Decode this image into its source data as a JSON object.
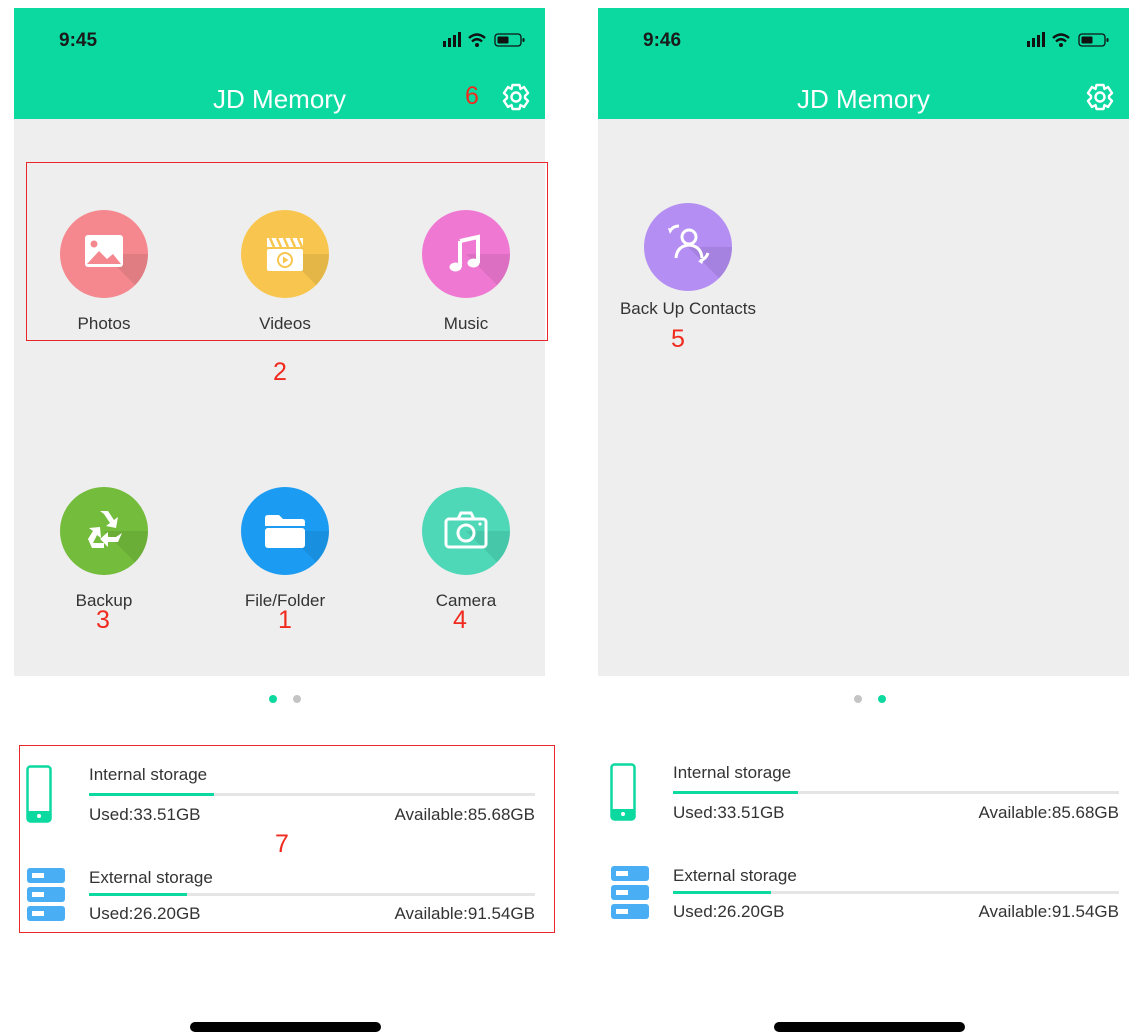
{
  "colors": {
    "accent": "#0cd9a0",
    "marker": "#f02a1e",
    "photos": "#f4888e",
    "videos": "#f8c64e",
    "music": "#ef79d2",
    "backup": "#74bc3c",
    "folder": "#1b9cf2",
    "camera": "#4ed8b8",
    "contacts": "#b48ef2"
  },
  "screen_a": {
    "time": "9:45",
    "title": "JD Memory",
    "tiles": [
      {
        "label": "Photos",
        "icon": "image-icon"
      },
      {
        "label": "Videos",
        "icon": "clapperboard-icon"
      },
      {
        "label": "Music",
        "icon": "music-note-icon"
      },
      {
        "label": "Backup",
        "icon": "recycle-icon"
      },
      {
        "label": "File/Folder",
        "icon": "folder-icon"
      },
      {
        "label": "Camera",
        "icon": "camera-icon"
      }
    ],
    "markers": {
      "settings": "6",
      "tile_group": "2",
      "backup": "3",
      "folder": "1",
      "camera": "4",
      "storage": "7"
    },
    "page_index": 1,
    "page_count": 2,
    "internal": {
      "title": "Internal storage",
      "used": "Used:33.51GB",
      "available": "Available:85.68GB",
      "fill_fraction": 0.28
    },
    "external": {
      "title": "External storage",
      "used": "Used:26.20GB",
      "available": "Available:91.54GB",
      "fill_fraction": 0.22
    }
  },
  "screen_b": {
    "time": "9:46",
    "title": "JD Memory",
    "tiles": [
      {
        "label": "Back Up Contacts",
        "icon": "contacts-sync-icon"
      }
    ],
    "markers": {
      "contacts": "5"
    },
    "page_index": 2,
    "page_count": 2,
    "internal": {
      "title": "Internal storage",
      "used": "Used:33.51GB",
      "available": "Available:85.68GB",
      "fill_fraction": 0.28
    },
    "external": {
      "title": "External storage",
      "used": "Used:26.20GB",
      "available": "Available:91.54GB",
      "fill_fraction": 0.22
    }
  }
}
